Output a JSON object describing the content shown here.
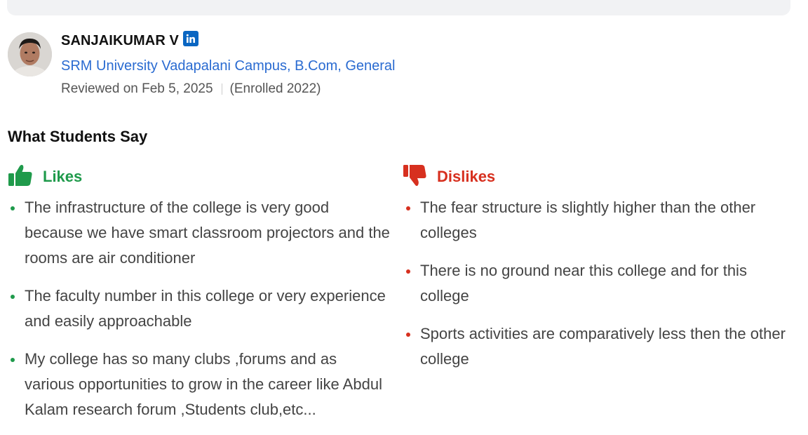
{
  "reviewer": {
    "name": "SANJAIKUMAR V",
    "college": "SRM University Vadapalani Campus",
    "separator": ",",
    "course": "B.Com, General",
    "reviewed_on": "Reviewed on Feb 5, 2025",
    "enrolled": "(Enrolled 2022)"
  },
  "section": {
    "title": "What Students Say"
  },
  "likes": {
    "label": "Likes",
    "color": "#1f9a4b",
    "items": [
      "The infrastructure of the college is very good because we have smart classroom projectors and the rooms are air conditioner",
      "The faculty number in this college or very experience and easily approachable",
      "My college has so many clubs ,forums and as various opportunities to grow in the career like Abdul Kalam research forum ,Students club,etc..."
    ]
  },
  "dislikes": {
    "label": "Dislikes",
    "color": "#d7301f",
    "items": [
      "The fear structure is slightly higher than the other colleges",
      "There is no ground near this college and for this college",
      "Sports activities are comparatively less then the other college"
    ]
  },
  "icons": {
    "linkedin": "linkedin-icon",
    "like": "thumbs-up-icon",
    "dislike": "thumbs-down-icon"
  }
}
